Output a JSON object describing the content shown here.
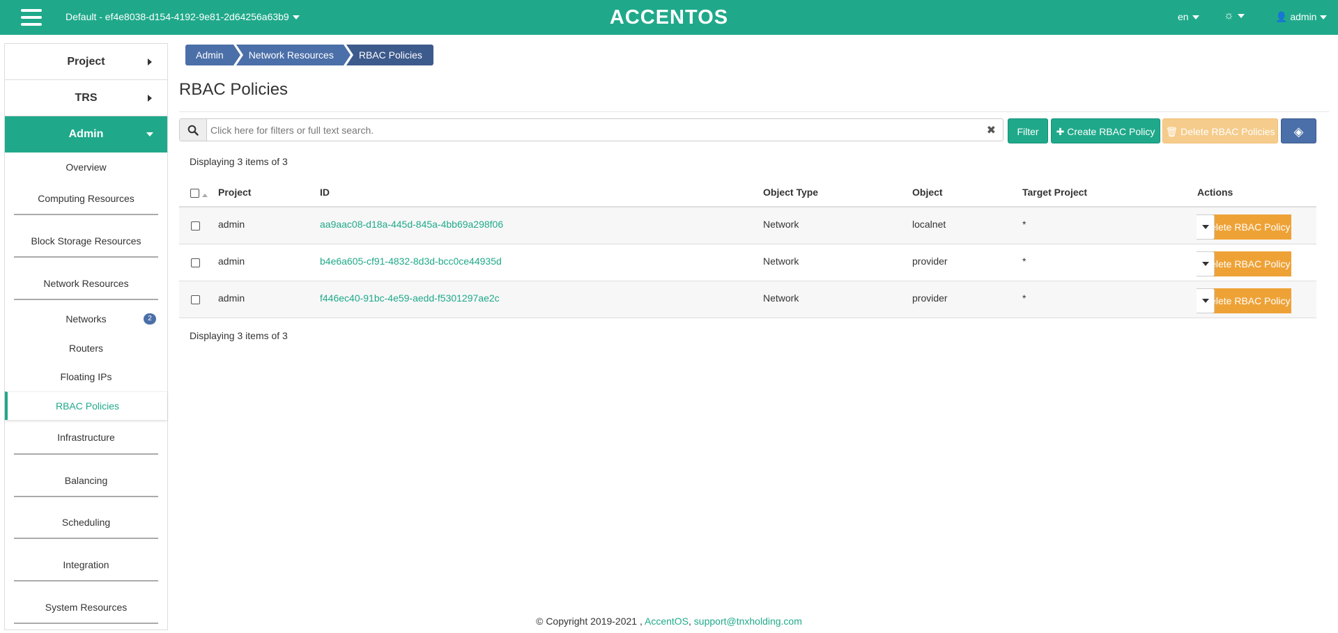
{
  "topbar": {
    "project": "Default - ef4e8038-d154-4192-9e81-2d64256a63b9",
    "logo": "ACCENTOS",
    "lang": "en",
    "user": "admin"
  },
  "sidebar": {
    "project": "Project",
    "trs": "TRS",
    "admin": "Admin",
    "overview": "Overview",
    "computing": "Computing Resources",
    "block_storage": "Block Storage Resources",
    "network": "Network Resources",
    "networks": "Networks",
    "networks_badge": "2",
    "routers": "Routers",
    "floating_ips": "Floating IPs",
    "rbac": "RBAC Policies",
    "infrastructure": "Infrastructure",
    "balancing": "Balancing",
    "scheduling": "Scheduling",
    "integration": "Integration",
    "system": "System Resources"
  },
  "breadcrumb": [
    "Admin",
    "Network Resources",
    "RBAC Policies"
  ],
  "page_title": "RBAC Policies",
  "search": {
    "placeholder": "Click here for filters or full text search."
  },
  "buttons": {
    "filter": "Filter",
    "create": "Create RBAC Policy",
    "delete": "Delete RBAC Policies"
  },
  "count_text": "Displaying 3 items of 3",
  "table": {
    "headers": [
      "Project",
      "ID",
      "Object Type",
      "Object",
      "Target Project",
      "Actions"
    ],
    "rows": [
      {
        "project": "admin",
        "id": "aa9aac08-d18a-445d-845a-4bb69a298f06",
        "object_type": "Network",
        "object": "localnet",
        "target": "*",
        "action": "Delete RBAC Policy"
      },
      {
        "project": "admin",
        "id": "b4e6a605-cf91-4832-8d3d-bcc0ce44935d",
        "object_type": "Network",
        "object": "provider",
        "target": "*",
        "action": "Delete RBAC Policy"
      },
      {
        "project": "admin",
        "id": "f446ec40-91bc-4e59-aedd-f5301297ae2c",
        "object_type": "Network",
        "object": "provider",
        "target": "*",
        "action": "Delete RBAC Policy"
      }
    ]
  },
  "footer": {
    "copyright": "© Copyright 2019-2021 ,",
    "brand": "AccentOS",
    "sep": ",",
    "email": "support@tnxholding.com"
  },
  "colors": {
    "primary": "#1fa98a",
    "accent_blue": "#4b6fa8",
    "warning": "#eea236"
  }
}
